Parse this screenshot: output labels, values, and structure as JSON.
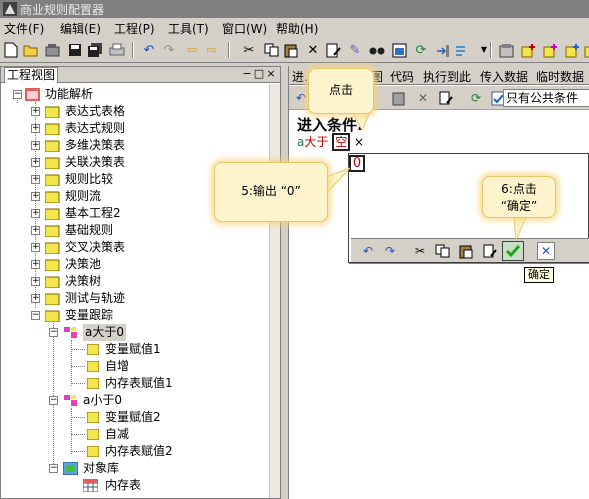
{
  "window": {
    "title": "商业规则配置器"
  },
  "menu": [
    "文件(F)",
    "编辑(E)",
    "工程(P)",
    "工具(T)",
    "窗口(W)",
    "帮助(H)"
  ],
  "toolbar": {
    "icons": [
      "new-icon",
      "open-icon",
      "open-folder-icon",
      "save-icon",
      "save-all-icon",
      "print-icon",
      "undo-icon",
      "redo-icon",
      "back-arrow-icon",
      "forward-arrow-icon",
      "cut-icon",
      "copy-icon",
      "paste-icon",
      "delete-icon",
      "edit-icon",
      "wand-icon",
      "find-icon",
      "properties-icon",
      "refresh-icon",
      "input-icon",
      "dropdown-icon",
      "settings-icon",
      "rule-add-icon",
      "rule-new-icon",
      "rule-copy-icon",
      "rule-export-icon"
    ]
  },
  "left_panel": {
    "title": "工程视图",
    "controls": [
      "−",
      "□",
      "×"
    ],
    "tree": {
      "root": "功能解析",
      "items": [
        "表达式表格",
        "表达式规则",
        "多维决策表",
        "关联决策表",
        "规则比较",
        "规则流",
        "基本工程2",
        "基础规则",
        "交叉决策表",
        "决策池",
        "决策树",
        "测试与轨迹"
      ],
      "tracking": "变量跟踪",
      "gt_node": "a大于0",
      "gt_children": [
        "变量赋值1",
        "自增",
        "内存表赋值1"
      ],
      "lt_node": "a小于0",
      "lt_children": [
        "变量赋值2",
        "自减",
        "内存表赋值2"
      ],
      "objlib": "对象库",
      "objlib_child": "内存表"
    }
  },
  "right_panel": {
    "tabs": [
      "进…",
      "图",
      "代码",
      "执行到此",
      "传入数据",
      "临时数据"
    ],
    "combo": "只有公共条件",
    "condition_title": "进入条件:",
    "condition": {
      "var": "a",
      "op": "大于",
      "value": "空",
      "close": "×"
    },
    "edit_value": "0",
    "edit_toolbar": [
      "undo-icon",
      "redo-icon",
      "cut-icon",
      "copy-icon",
      "paste-icon",
      "edit-icon",
      "confirm-check-icon",
      "cancel-icon"
    ],
    "tooltip": "确定"
  },
  "callouts": {
    "click": "点击",
    "output": "5:输出 “0”",
    "confirm_line1": "6:点击",
    "confirm_line2": "“确定”"
  },
  "colors": {
    "accent_red": "#c00000",
    "callout_bg": "#fdf3cc",
    "folder_yellow": "#f2e64a"
  }
}
